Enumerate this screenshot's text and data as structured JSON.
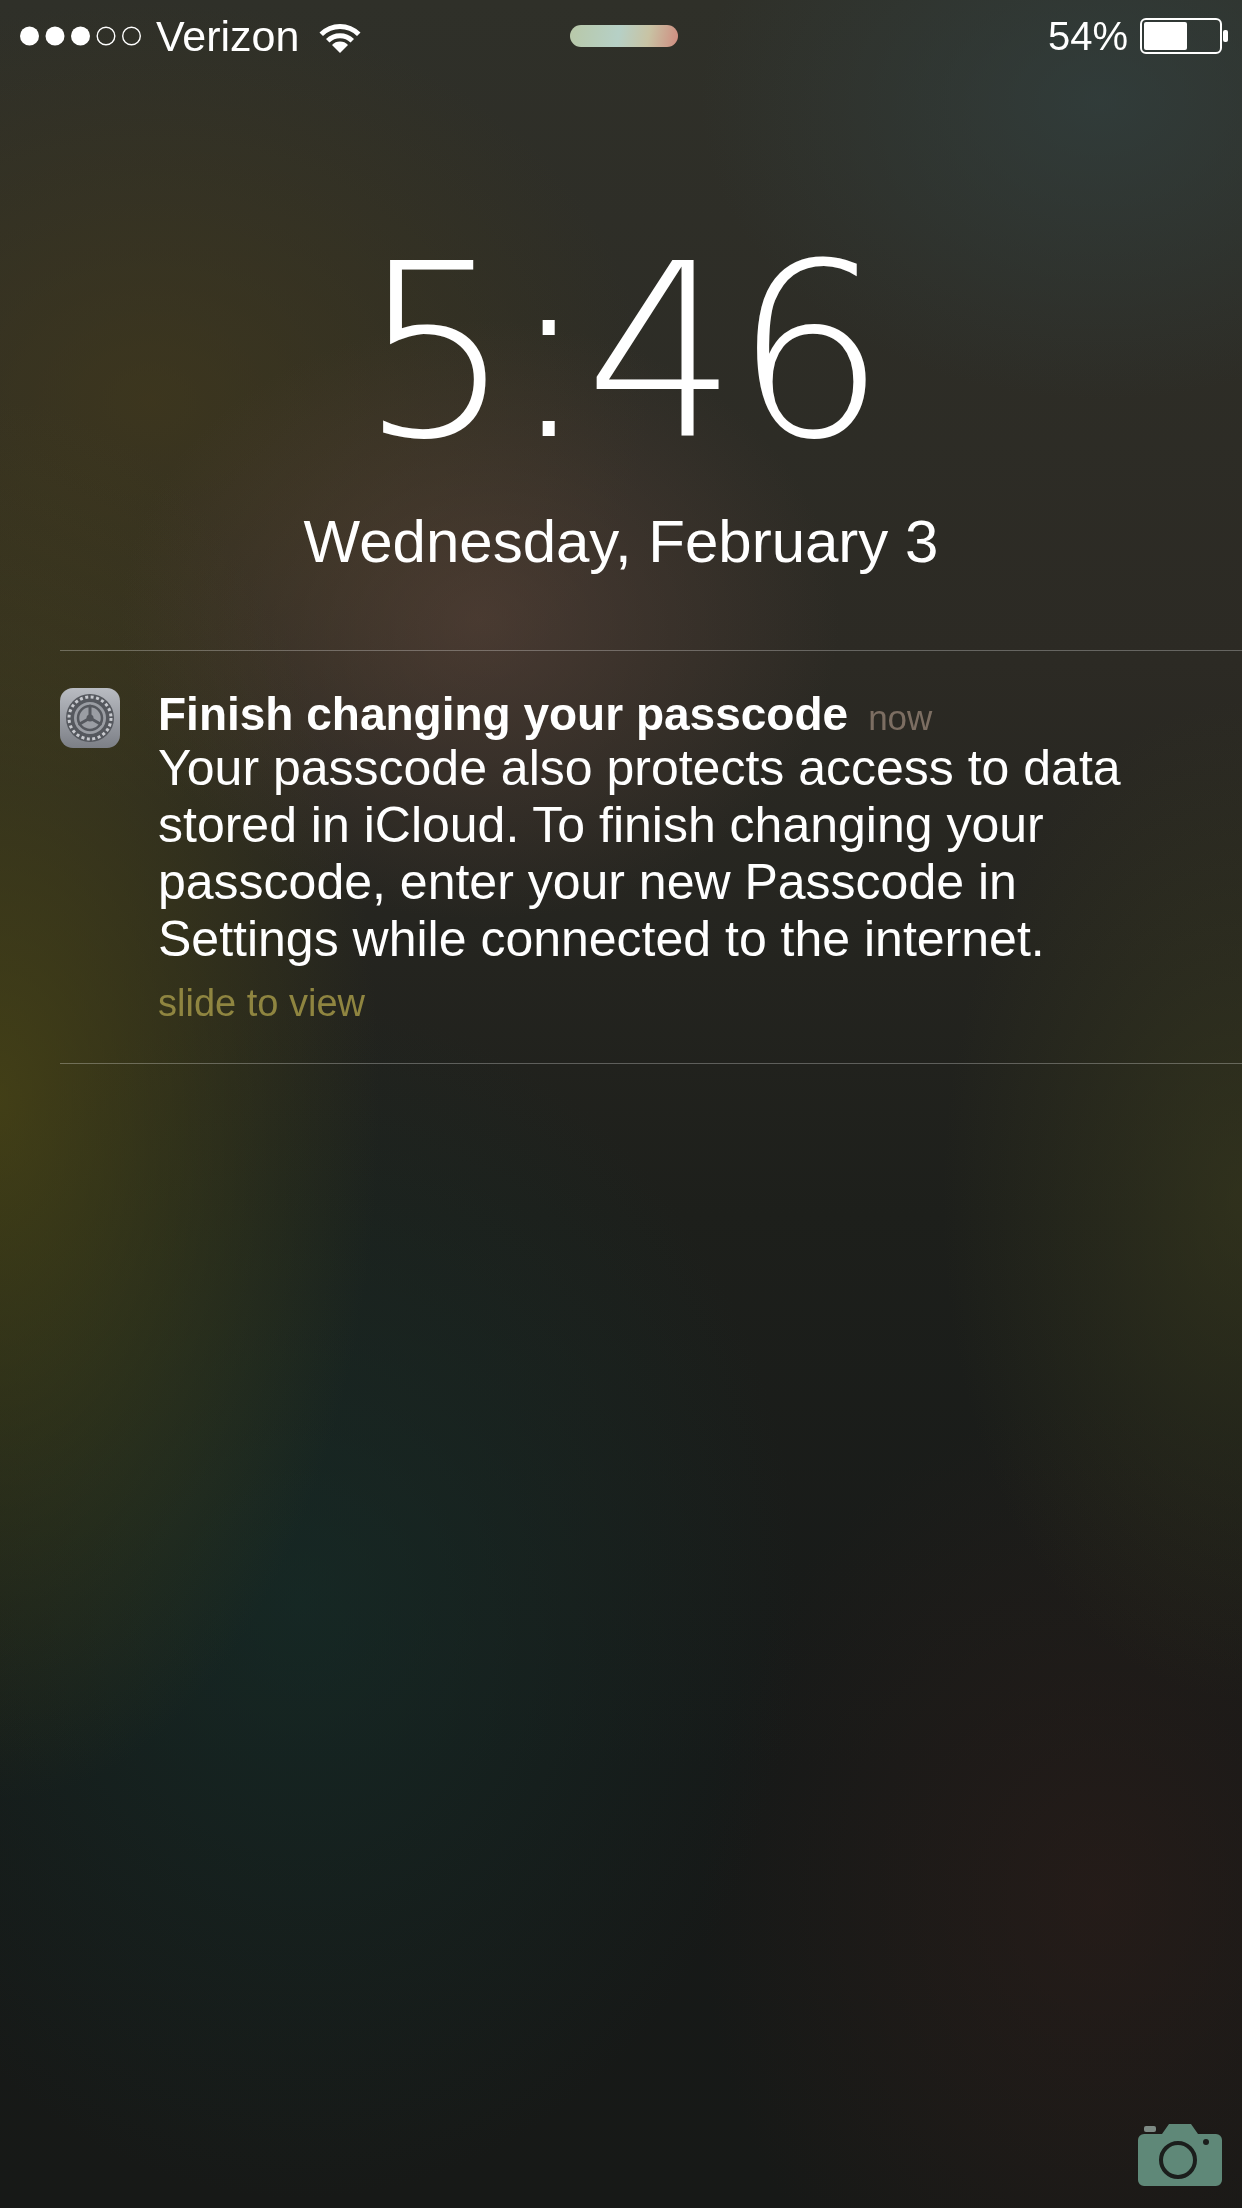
{
  "status_bar": {
    "carrier": "Verizon",
    "battery_percent": "54%"
  },
  "lock_screen": {
    "time": "5:46",
    "date": "Wednesday, February 3"
  },
  "notifications": [
    {
      "title": "Finish changing your passcode",
      "time": "now",
      "body": "Your passcode also protects access to data stored in iCloud. To finish changing your passcode, enter your new Passcode in Settings while connected to the internet.",
      "action_hint": "slide to view"
    }
  ]
}
